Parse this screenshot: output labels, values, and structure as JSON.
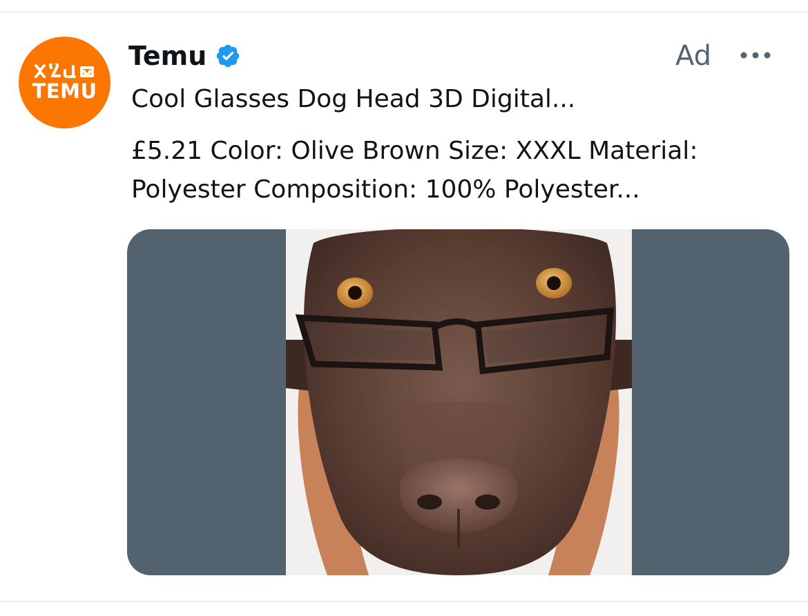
{
  "post": {
    "author": {
      "name": "Temu",
      "avatar_text": "TEMU",
      "verified_icon": "verified-badge-icon"
    },
    "ad_label": "Ad",
    "more_icon": "more-horizontal-icon",
    "title": "Cool Glasses Dog Head 3D Digital...",
    "body": "£5.21 Color: Olive Brown Size: XXXL Material: Polyester Composition: 100% Polyester..."
  },
  "colors": {
    "brand_orange": "#fb7701",
    "verified_blue": "#1d9bf0",
    "secondary_text": "#536471",
    "media_background": "#52626e"
  }
}
